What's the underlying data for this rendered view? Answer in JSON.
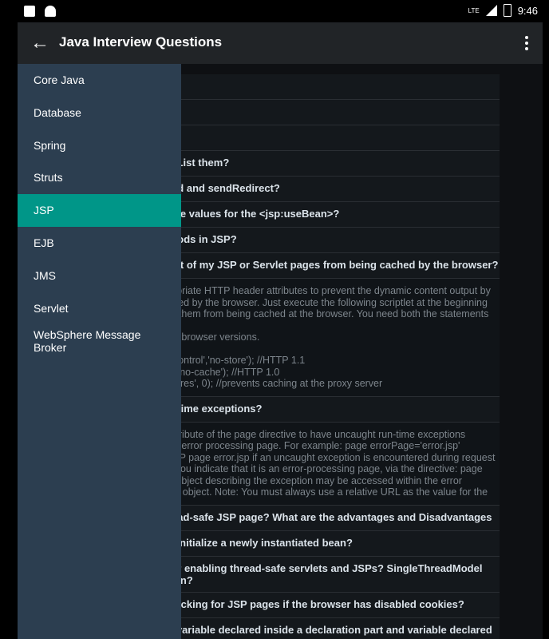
{
  "status": {
    "time": "9:46",
    "network": "LTE"
  },
  "appbar": {
    "title": "Java Interview Questions"
  },
  "drawer": {
    "items": [
      {
        "label": "Core Java"
      },
      {
        "label": "Database"
      },
      {
        "label": "Spring"
      },
      {
        "label": "Struts"
      },
      {
        "label": "JSP",
        "active": true
      },
      {
        "label": "EJB"
      },
      {
        "label": "JMS"
      },
      {
        "label": "Servlet"
      },
      {
        "label": "WebSphere Message\nBroker"
      }
    ]
  },
  "content": {
    "rows": [
      {
        "text": ""
      },
      {
        "text": ""
      },
      {
        "text": ""
      },
      {
        "text": "? List them?"
      },
      {
        "text": "ard and sendRedirect?"
      },
      {
        "text": "ope values for the <jsp:useBean>?"
      },
      {
        "text": "ntods in JSP?"
      },
      {
        "text": "out of my JSP or Servlet pages from being cached by the browser?"
      },
      {
        "answer": "ropriate HTTP header attributes to prevent the dynamic content output by\nched by the browser. Just execute the following scriptlet at the beginning\nnt them from being cached at the browser. You need both the statements to\nler browser versions.\n\n-Control','no-store'); //HTTP 1.1\na','no-cache'); //HTTP 1.0\nxpires', 0); //prevents caching at the proxy server"
      },
      {
        "text": "n-time exceptions?"
      },
      {
        "answer": "attribute of the page directive to have uncaught run-time exceptions\nan error processing page. For example: page errorPage='error.jsp'\nJSP page error.jsp if an uncaught exception is encountered during request\nif you indicate that it is an error-processing page, via the directive: page\ne object describing the exception may be accessed within the error\nicit object. Note: You must always use a relative URL as the value for the"
      },
      {
        "text": "read-safe JSP page? What are the advantages and Disadvantages\n"
      },
      {
        "text": "o initialize a newly instantiated bean?"
      },
      {
        "text": "for enabling thread-safe servlets and JSPs? SingleThreadModel\ntion?"
      },
      {
        "text": "tracking for JSP pages if the browser has disabled cookies?"
      },
      {
        "text": "v variable declared inside a declaration part and variable declared"
      }
    ]
  }
}
